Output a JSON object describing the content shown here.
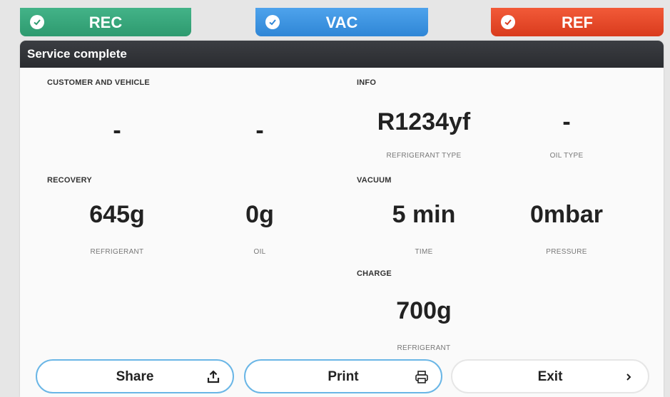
{
  "tabs": [
    {
      "label": "REC",
      "color": "#2e9a6f"
    },
    {
      "label": "VAC",
      "color": "#2f86d6"
    },
    {
      "label": "REF",
      "color": "#d93b1d"
    }
  ],
  "header": {
    "title": "Service complete"
  },
  "customer": {
    "title": "CUSTOMER AND VEHICLE",
    "value1": "-",
    "value2": "-"
  },
  "info": {
    "title": "INFO",
    "refrigerant_type": {
      "value": "R1234yf",
      "label": "REFRIGERANT TYPE"
    },
    "oil_type": {
      "value": "-",
      "label": "OIL TYPE"
    }
  },
  "recovery": {
    "title": "RECOVERY",
    "refrigerant": {
      "value": "645g",
      "label": "REFRIGERANT"
    },
    "oil": {
      "value": "0g",
      "label": "OIL"
    }
  },
  "vacuum": {
    "title": "VACUUM",
    "time": {
      "value": "5 min",
      "label": "TIME"
    },
    "pressure": {
      "value": "0mbar",
      "label": "PRESSURE"
    }
  },
  "charge": {
    "title": "CHARGE",
    "refrigerant": {
      "value": "700g",
      "label": "REFRIGERANT"
    }
  },
  "buttons": {
    "share": "Share",
    "print": "Print",
    "exit": "Exit"
  },
  "icons": {
    "check": "check-icon",
    "share": "upload-icon",
    "print": "printer-icon",
    "exit": "chevron-right-icon"
  }
}
